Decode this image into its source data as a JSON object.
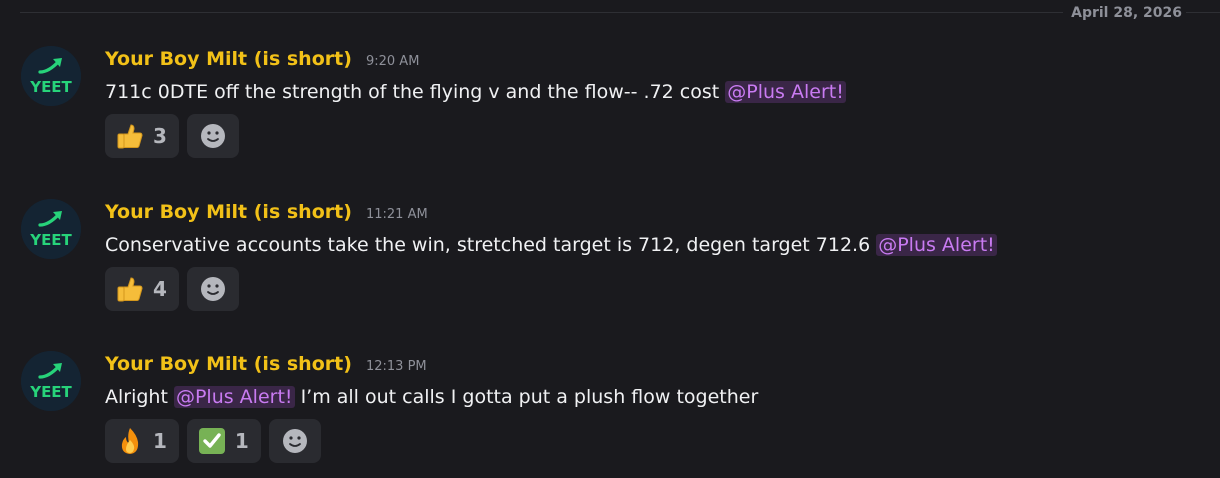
{
  "date_divider": "April 28, 2026",
  "avatar_text": "YEET",
  "colors": {
    "username": "#f2c118",
    "mention_text": "#c97bf2",
    "mention_bg": "#3a2647",
    "background": "#1a1a1e",
    "reaction_bg": "#2a2b30",
    "avatar_bg": "#142433",
    "avatar_accent": "#27d37a"
  },
  "messages": [
    {
      "username": "Your Boy Milt (is short)",
      "time": "9:20 AM",
      "text_before": "711c 0DTE off the strength of the flying v and the flow-- .72 cost ",
      "mention": "@Plus Alert!",
      "text_after": "",
      "reactions": [
        {
          "emoji": "thumbs-up",
          "count": "3"
        }
      ]
    },
    {
      "username": "Your Boy Milt (is short)",
      "time": "11:21 AM",
      "text_before": "Conservative accounts take the win, stretched target is 712, degen target 712.6 ",
      "mention": "@Plus Alert!",
      "text_after": "",
      "reactions": [
        {
          "emoji": "thumbs-up",
          "count": "4"
        }
      ]
    },
    {
      "username": "Your Boy Milt (is short)",
      "time": "12:13 PM",
      "text_before": "Alright ",
      "mention": "@Plus Alert!",
      "text_after": " I’m all out calls I gotta put a plush flow together",
      "reactions": [
        {
          "emoji": "fire",
          "count": "1"
        },
        {
          "emoji": "check-mark",
          "count": "1"
        }
      ]
    }
  ]
}
